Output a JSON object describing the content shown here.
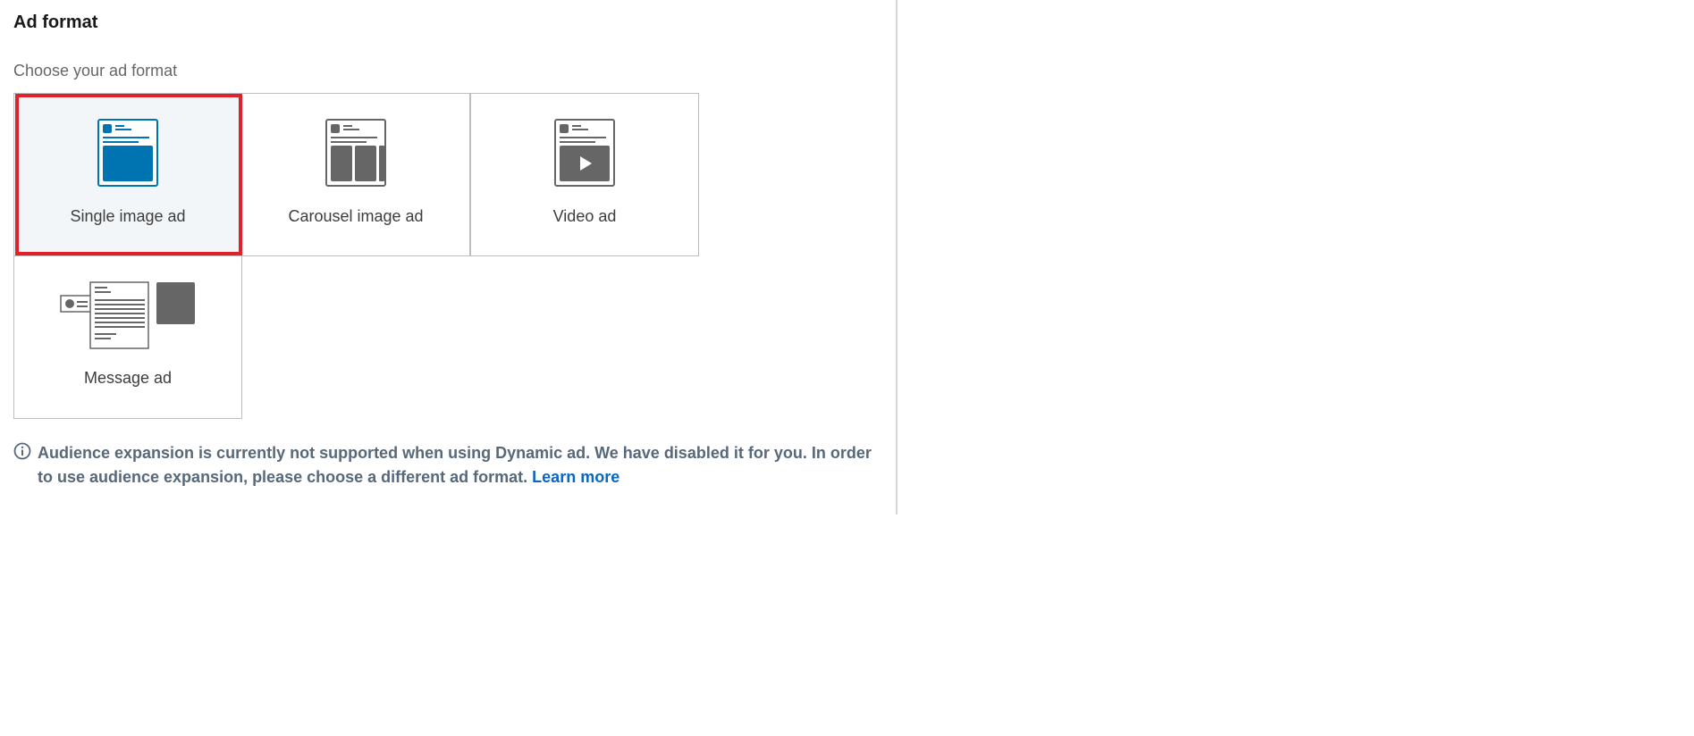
{
  "section": {
    "title": "Ad format",
    "subtitle": "Choose your ad format"
  },
  "formats": [
    {
      "label": "Single image ad",
      "icon": "single-image-ad-icon",
      "selected": true
    },
    {
      "label": "Carousel image ad",
      "icon": "carousel-image-ad-icon",
      "selected": false
    },
    {
      "label": "Video ad",
      "icon": "video-ad-icon",
      "selected": false
    },
    {
      "label": "Message ad",
      "icon": "message-ad-icon",
      "selected": false
    }
  ],
  "notice": {
    "icon": "info-icon",
    "text": "Audience expansion is currently not supported when using Dynamic ad. We have disabled it for you. In order to use audience expansion, please choose a different ad format.",
    "link_label": "Learn more"
  },
  "colors": {
    "accent_blue": "#0073b1",
    "selection_red": "#e0202a",
    "icon_gray": "#666666",
    "link_blue": "#0a66c2"
  }
}
